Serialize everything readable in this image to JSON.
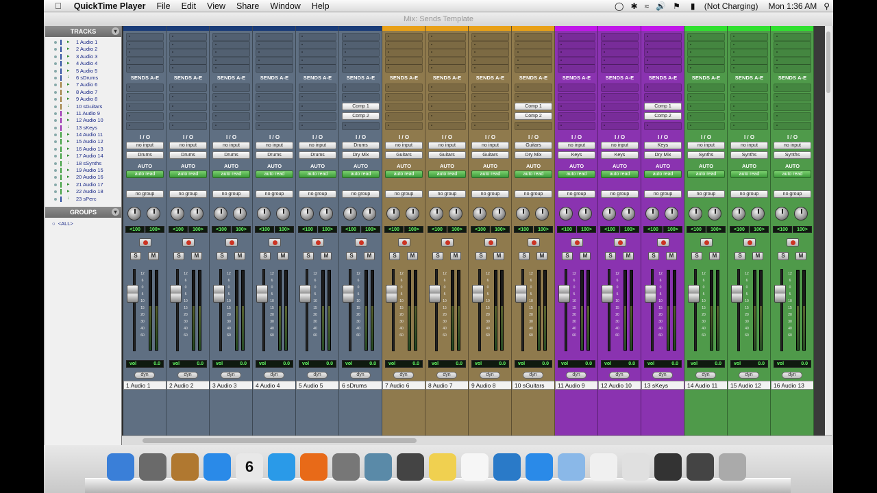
{
  "menubar": {
    "app": "QuickTime Player",
    "items": [
      "File",
      "Edit",
      "View",
      "Share",
      "Window",
      "Help"
    ],
    "battery": "(Not Charging)",
    "clock": "Mon 1:36 AM"
  },
  "window": {
    "title": "Mix: Sends Template"
  },
  "tracks_panel": {
    "header": "TRACKS",
    "items": [
      "1 Audio 1",
      "2 Audio 2",
      "3 Audio 3",
      "4 Audio 4",
      "5 Audio 5",
      "6 sDrums",
      "7 Audio 6",
      "8 Audio 7",
      "9 Audio 8",
      "10 sGuitars",
      "11 Audio 9",
      "12 Audio 10",
      "13 sKeys",
      "14 Audio 11",
      "15 Audio 12",
      "16 Audio 13",
      "17 Audio 14",
      "18 sSynths",
      "19 Audio 15",
      "20 Audio 16",
      "21 Audio 17",
      "22 Audio 18",
      "23 sPerc"
    ]
  },
  "groups_panel": {
    "header": "GROUPS",
    "items": [
      "<ALL>"
    ]
  },
  "strip_labels": {
    "sends": "SENDS A-E",
    "io": "I / O",
    "auto": "AUTO",
    "pan_left": "<100",
    "pan_right": "100>",
    "solo": "S",
    "mute": "M",
    "vol": "vol",
    "dyn": "dyn"
  },
  "fader_scale": [
    "12",
    "6",
    "0",
    "5",
    "10",
    "15",
    "20",
    "30",
    "40",
    "60"
  ],
  "colors": {
    "drums": "#5f6f82",
    "guitars": "#8f7a4d",
    "keys": "#8a33b0",
    "synths": "#4f9a4a"
  },
  "strips": [
    {
      "name": "1  Audio 1",
      "input": "no input",
      "output": "Drums",
      "auto": "auto read",
      "group": "no group",
      "vol": "0.0",
      "color": "drums",
      "sends": []
    },
    {
      "name": "2  Audio 2",
      "input": "no input",
      "output": "Drums",
      "auto": "auto read",
      "group": "no group",
      "vol": "0.0",
      "color": "drums",
      "sends": []
    },
    {
      "name": "3  Audio 3",
      "input": "no input",
      "output": "Drums",
      "auto": "auto read",
      "group": "no group",
      "vol": "0.0",
      "color": "drums",
      "sends": []
    },
    {
      "name": "4  Audio 4",
      "input": "no input",
      "output": "Drums",
      "auto": "auto read",
      "group": "no group",
      "vol": "0.0",
      "color": "drums",
      "sends": []
    },
    {
      "name": "5  Audio 5",
      "input": "no input",
      "output": "Drums",
      "auto": "auto read",
      "group": "no group",
      "vol": "0.0",
      "color": "drums",
      "sends": []
    },
    {
      "name": "6  sDrums",
      "input": "Drums",
      "output": "Dry Mix",
      "auto": "auto read",
      "group": "no group",
      "vol": "0.0",
      "color": "drums",
      "sends": [
        "Comp 1",
        "Comp 2"
      ]
    },
    {
      "name": "7  Audio 6",
      "input": "no input",
      "output": "Guitars",
      "auto": "auto read",
      "group": "no group",
      "vol": "0.0",
      "color": "guitars",
      "sends": []
    },
    {
      "name": "8  Audio 7",
      "input": "no input",
      "output": "Guitars",
      "auto": "auto read",
      "group": "no group",
      "vol": "0.0",
      "color": "guitars",
      "sends": []
    },
    {
      "name": "9  Audio 8",
      "input": "no input",
      "output": "Guitars",
      "auto": "auto read",
      "group": "no group",
      "vol": "0.0",
      "color": "guitars",
      "sends": []
    },
    {
      "name": "10 sGuitars",
      "input": "Guitars",
      "output": "Dry Mix",
      "auto": "auto read",
      "group": "no group",
      "vol": "0.0",
      "color": "guitars",
      "sends": [
        "Comp 1",
        "Comp 2"
      ]
    },
    {
      "name": "11  Audio 9",
      "input": "no input",
      "output": "Keys",
      "auto": "auto read",
      "group": "no group",
      "vol": "0.0",
      "color": "keys",
      "sends": []
    },
    {
      "name": "12 Audio 10",
      "input": "no input",
      "output": "Keys",
      "auto": "auto read",
      "group": "no group",
      "vol": "0.0",
      "color": "keys",
      "sends": []
    },
    {
      "name": "13  sKeys",
      "input": "Keys",
      "output": "Dry Mix",
      "auto": "auto read",
      "group": "no group",
      "vol": "0.0",
      "color": "keys",
      "sends": [
        "Comp 1",
        "Comp 2"
      ]
    },
    {
      "name": "14 Audio 11",
      "input": "no input",
      "output": "Synths",
      "auto": "auto read",
      "group": "no group",
      "vol": "0.0",
      "color": "synths",
      "sends": []
    },
    {
      "name": "15 Audio 12",
      "input": "no input",
      "output": "Synths",
      "auto": "auto read",
      "group": "no group",
      "vol": "0.0",
      "color": "synths",
      "sends": []
    },
    {
      "name": "16 Audio 13",
      "input": "no input",
      "output": "Synths",
      "auto": "auto read",
      "group": "no group",
      "vol": "0.0",
      "color": "synths",
      "sends": []
    }
  ],
  "dock": {
    "icons": [
      "finder-icon",
      "launchpad-icon",
      "contacts-icon",
      "appstore-icon",
      "calendar-icon",
      "itunes-icon",
      "firefox-icon",
      "system-prefs-icon",
      "preview-icon",
      "protools-icon",
      "stickies-icon",
      "textedit-icon",
      "quicktime-icon",
      "word-icon",
      "folder-icon",
      "document-icon",
      "grab-icon",
      "terminal-icon",
      "mixer-icon",
      "trash-icon"
    ],
    "calendar_day": "6"
  }
}
